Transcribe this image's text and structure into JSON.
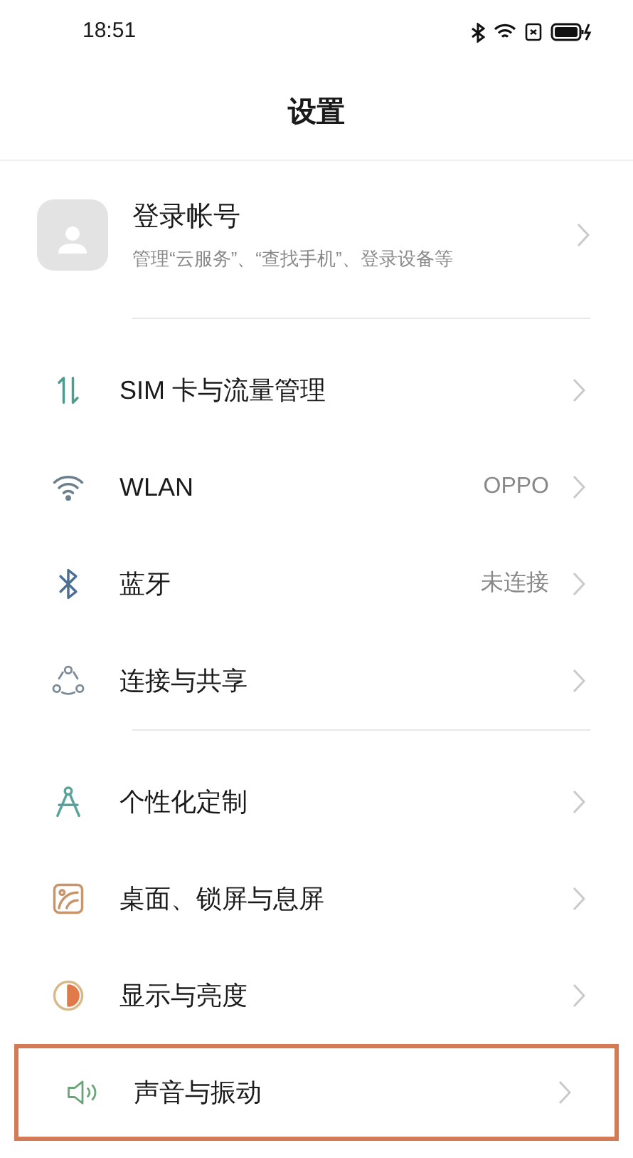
{
  "status_bar": {
    "time": "18:51"
  },
  "header": {
    "title": "设置"
  },
  "account": {
    "title": "登录帐号",
    "subtitle": "管理“云服务”、“查找手机”、登录设备等"
  },
  "groups": [
    {
      "items": [
        {
          "kind": "sim",
          "label": "SIM 卡与流量管理",
          "highlighted": false
        },
        {
          "kind": "wifi",
          "label": "WLAN",
          "value": "OPPO",
          "highlighted": false
        },
        {
          "kind": "bluetooth",
          "label": "蓝牙",
          "value": "未连接",
          "highlighted": false
        },
        {
          "kind": "share",
          "label": "连接与共享",
          "highlighted": false
        }
      ]
    },
    {
      "items": [
        {
          "kind": "personalize",
          "label": "个性化定制",
          "highlighted": false
        },
        {
          "kind": "wallpaper",
          "label": "桌面、锁屏与息屏",
          "highlighted": false
        },
        {
          "kind": "display",
          "label": "显示与亮度",
          "highlighted": false
        },
        {
          "kind": "sound",
          "label": "声音与振动",
          "highlighted": true
        }
      ]
    }
  ]
}
